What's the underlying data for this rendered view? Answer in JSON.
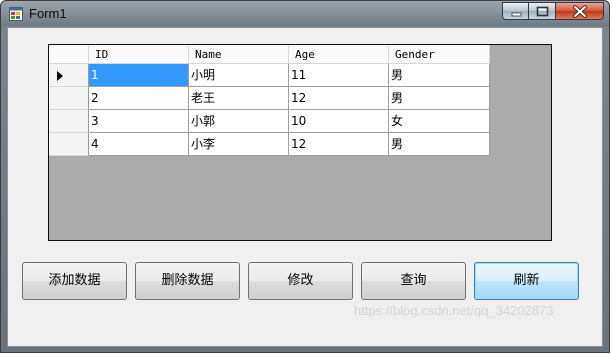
{
  "window": {
    "title": "Form1",
    "icon": "form-app-icon"
  },
  "controls": {
    "minimize_icon": "minimize-icon",
    "maximize_icon": "maximize-icon",
    "close_icon": "close-icon"
  },
  "grid": {
    "columns": [
      "ID",
      "Name",
      "Age",
      "Gender"
    ],
    "rows": [
      [
        "1",
        "小明",
        "11",
        "男"
      ],
      [
        "2",
        "老王",
        "12",
        "男"
      ],
      [
        "3",
        "小郭",
        "10",
        "女"
      ],
      [
        "4",
        "小李",
        "12",
        "男"
      ]
    ],
    "current_row_indicator": "row-pointer-arrow-icon",
    "colors": {
      "selection": "#3399ff",
      "background": "#ababab"
    }
  },
  "buttons": {
    "add": "添加数据",
    "delete": "删除数据",
    "edit": "修改",
    "query": "查询",
    "refresh": "刷新"
  },
  "watermark": "https://blog.csdn.net/qq_34202873"
}
